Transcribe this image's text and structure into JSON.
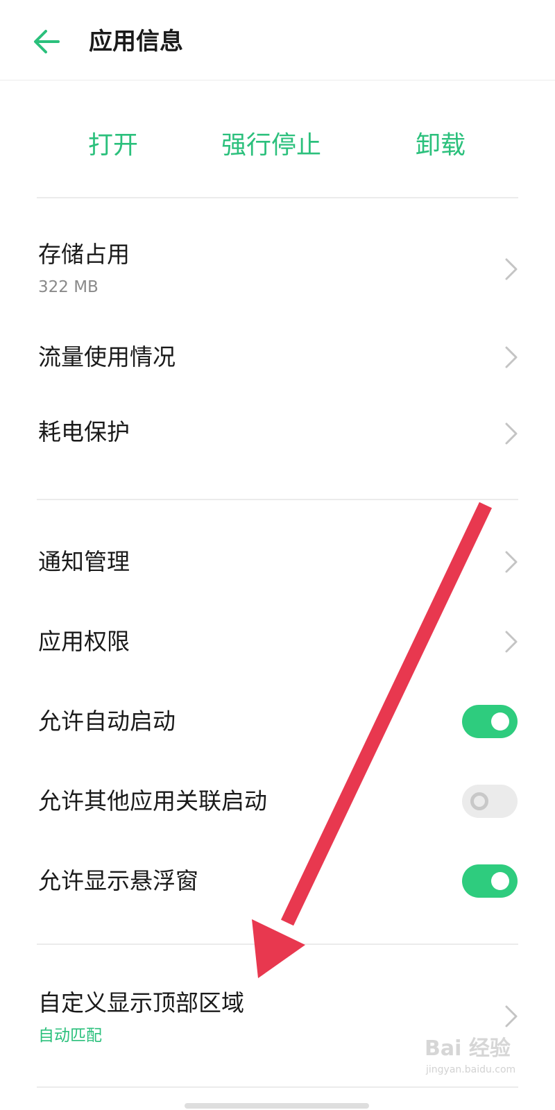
{
  "header": {
    "title": "应用信息",
    "back_icon": "arrow-left-icon",
    "accent_color": "#2bc07c"
  },
  "actions": {
    "open": "打开",
    "force_stop": "强行停止",
    "uninstall": "卸载"
  },
  "sections": {
    "storage": {
      "title": "存储占用",
      "value": "322 MB"
    },
    "data_usage": {
      "title": "流量使用情况"
    },
    "battery": {
      "title": "耗电保护"
    },
    "notifications": {
      "title": "通知管理"
    },
    "permissions": {
      "title": "应用权限"
    },
    "auto_start": {
      "title": "允许自动启动",
      "enabled": true
    },
    "associated_start": {
      "title": "允许其他应用关联启动",
      "enabled": false
    },
    "floating_window": {
      "title": "允许显示悬浮窗",
      "enabled": true
    },
    "top_area": {
      "title": "自定义显示顶部区域",
      "value": "自动匹配"
    }
  },
  "annotation": {
    "color": "#e8384f",
    "icon": "red-arrow-annotation"
  },
  "watermark": {
    "brand": "Bai 经验",
    "url": "jingyan.baidu.com"
  }
}
